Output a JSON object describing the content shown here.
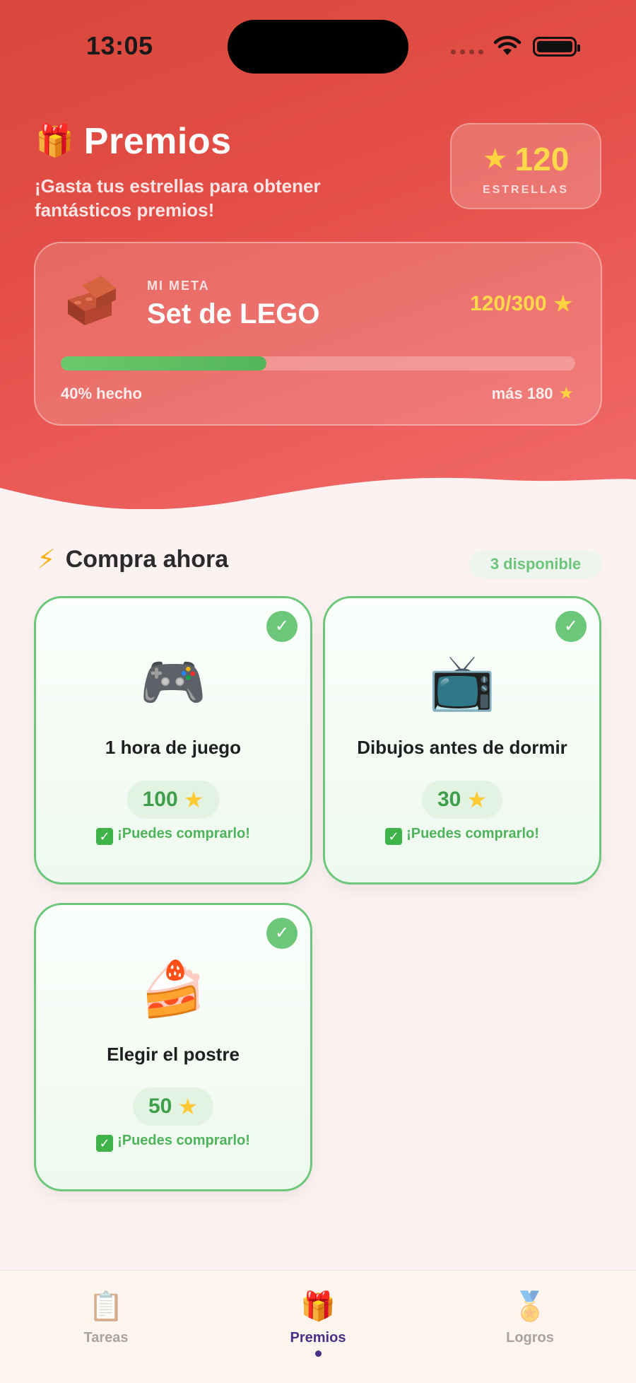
{
  "status_bar": {
    "time": "13:05"
  },
  "header": {
    "title": "Premios",
    "title_icon": "gift-icon",
    "subtitle": "¡Gasta tus estrellas para obtener fantásticos premios!",
    "stars_count": "120",
    "stars_label": "ESTRELLAS"
  },
  "goal": {
    "label": "MI META",
    "name": "Set de LEGO",
    "icon": "bricks-icon",
    "progress_text": "120/300",
    "progress_fraction": 0.4,
    "done_text": "40% hecho",
    "remaining_text": "más 180"
  },
  "section": {
    "title": "Compra ahora",
    "available_badge": "3 disponible"
  },
  "rewards": [
    {
      "emoji": "🎮",
      "icon": "gamepad-icon",
      "name": "1 hora de juego",
      "price": "100",
      "status": "¡Puedes comprarlo!"
    },
    {
      "emoji": "📺",
      "icon": "tv-icon",
      "name": "Dibujos antes de dormir",
      "price": "30",
      "status": "¡Puedes comprarlo!"
    },
    {
      "emoji": "🍰",
      "icon": "cake-icon",
      "name": "Elegir el postre",
      "price": "50",
      "status": "¡Puedes comprarlo!"
    }
  ],
  "tabs": [
    {
      "label": "Tareas",
      "icon": "clipboard-icon",
      "active": false
    },
    {
      "label": "Premios",
      "icon": "gift-icon",
      "active": true
    },
    {
      "label": "Logros",
      "icon": "medal-icon",
      "active": false
    }
  ],
  "colors": {
    "header_start": "#d8473b",
    "header_end": "#f26b6b",
    "accent_green": "#6cc77a",
    "star_yellow": "#ffd23f",
    "active_tab": "#4a2f86"
  }
}
